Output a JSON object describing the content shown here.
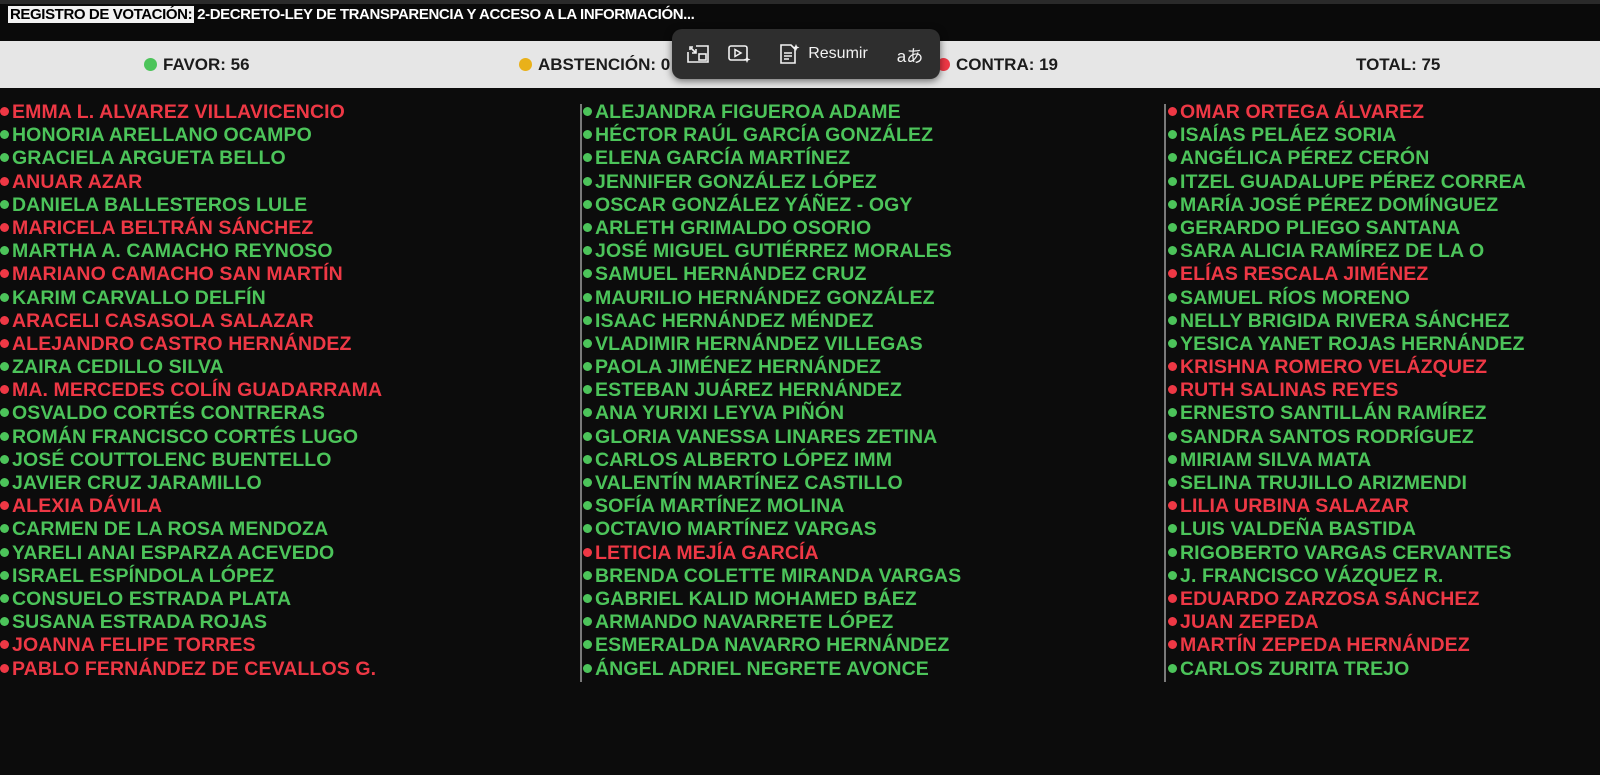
{
  "title": {
    "label": "REGISTRO DE VOTACIÓN:",
    "value": "2-DECRETO-LEY DE TRANSPARENCIA Y ACCESO A LA INFORMACIÓN..."
  },
  "summary": {
    "favor": "FAVOR: 56",
    "abstencion": "ABSTENCIÓN: 0",
    "contra": "CONTRA: 19",
    "total": "TOTAL: 75"
  },
  "colors": {
    "favor": "#4cc45a",
    "abstencion": "#e9b11a",
    "contra": "#ee3845"
  },
  "toolbar": {
    "buttons": [
      {
        "icon": "picture-in-picture-icon"
      },
      {
        "icon": "video-sparkle-icon"
      },
      {
        "icon": "summarize-icon",
        "label": "Resumir"
      },
      {
        "icon": "translate-icon",
        "glyph": "aあ"
      }
    ]
  },
  "columns": [
    [
      {
        "name": "EMMA L. ALVAREZ VILLAVICENCIO",
        "vote": "contra"
      },
      {
        "name": "HONORIA ARELLANO OCAMPO",
        "vote": "favor"
      },
      {
        "name": "GRACIELA ARGUETA BELLO",
        "vote": "favor"
      },
      {
        "name": "ANUAR AZAR",
        "vote": "contra"
      },
      {
        "name": "DANIELA BALLESTEROS LULE",
        "vote": "favor"
      },
      {
        "name": "MARICELA BELTRÁN SÁNCHEZ",
        "vote": "contra"
      },
      {
        "name": "MARTHA A. CAMACHO REYNOSO",
        "vote": "favor"
      },
      {
        "name": "MARIANO CAMACHO SAN MARTÍN",
        "vote": "contra"
      },
      {
        "name": "KARIM CARVALLO DELFÍN",
        "vote": "favor"
      },
      {
        "name": "ARACELI CASASOLA SALAZAR",
        "vote": "contra"
      },
      {
        "name": "ALEJANDRO CASTRO HERNÁNDEZ",
        "vote": "contra"
      },
      {
        "name": "ZAIRA CEDILLO SILVA",
        "vote": "favor"
      },
      {
        "name": "MA. MERCEDES COLÍN GUADARRAMA",
        "vote": "contra"
      },
      {
        "name": "OSVALDO CORTÉS CONTRERAS",
        "vote": "favor"
      },
      {
        "name": "ROMÁN FRANCISCO CORTÉS LUGO",
        "vote": "favor"
      },
      {
        "name": "JOSÉ COUTTOLENC BUENTELLO",
        "vote": "favor"
      },
      {
        "name": "JAVIER CRUZ JARAMILLO",
        "vote": "favor"
      },
      {
        "name": "ALEXIA DÁVILA",
        "vote": "contra"
      },
      {
        "name": "CARMEN DE LA ROSA MENDOZA",
        "vote": "favor"
      },
      {
        "name": "YARELI ANAI ESPARZA ACEVEDO",
        "vote": "favor"
      },
      {
        "name": "ISRAEL ESPÍNDOLA LÓPEZ",
        "vote": "favor"
      },
      {
        "name": "CONSUELO ESTRADA PLATA",
        "vote": "favor"
      },
      {
        "name": "SUSANA ESTRADA ROJAS",
        "vote": "favor"
      },
      {
        "name": "JOANNA FELIPE TORRES",
        "vote": "contra"
      },
      {
        "name": "PABLO FERNÁNDEZ DE CEVALLOS G.",
        "vote": "contra"
      }
    ],
    [
      {
        "name": "ALEJANDRA FIGUEROA ADAME",
        "vote": "favor"
      },
      {
        "name": "HÉCTOR RAÚL GARCÍA GONZÁLEZ",
        "vote": "favor"
      },
      {
        "name": "ELENA GARCÍA MARTÍNEZ",
        "vote": "favor"
      },
      {
        "name": "JENNIFER GONZÁLEZ LÓPEZ",
        "vote": "favor"
      },
      {
        "name": "OSCAR GONZÁLEZ YÁÑEZ - OGY",
        "vote": "favor"
      },
      {
        "name": "ARLETH GRIMALDO OSORIO",
        "vote": "favor"
      },
      {
        "name": "JOSÉ MIGUEL GUTIÉRREZ MORALES",
        "vote": "favor"
      },
      {
        "name": "SAMUEL HERNÁNDEZ CRUZ",
        "vote": "favor"
      },
      {
        "name": "MAURILIO HERNÁNDEZ GONZÁLEZ",
        "vote": "favor"
      },
      {
        "name": "ISAAC HERNÁNDEZ MÉNDEZ",
        "vote": "favor"
      },
      {
        "name": "VLADIMIR HERNÁNDEZ VILLEGAS",
        "vote": "favor"
      },
      {
        "name": "PAOLA JIMÉNEZ HERNÁNDEZ",
        "vote": "favor"
      },
      {
        "name": "ESTEBAN JUÁREZ HERNÁNDEZ",
        "vote": "favor"
      },
      {
        "name": "ANA YURIXI LEYVA PIÑÓN",
        "vote": "favor"
      },
      {
        "name": "GLORIA VANESSA LINARES ZETINA",
        "vote": "favor"
      },
      {
        "name": "CARLOS ALBERTO LÓPEZ IMM",
        "vote": "favor"
      },
      {
        "name": "VALENTÍN MARTÍNEZ CASTILLO",
        "vote": "favor"
      },
      {
        "name": "SOFÍA MARTÍNEZ MOLINA",
        "vote": "favor"
      },
      {
        "name": "OCTAVIO MARTÍNEZ VARGAS",
        "vote": "favor"
      },
      {
        "name": "LETICIA MEJÍA GARCÍA",
        "vote": "contra"
      },
      {
        "name": "BRENDA COLETTE MIRANDA VARGAS",
        "vote": "favor"
      },
      {
        "name": "GABRIEL KALID MOHAMED BÁEZ",
        "vote": "favor"
      },
      {
        "name": "ARMANDO NAVARRETE LÓPEZ",
        "vote": "favor"
      },
      {
        "name": "ESMERALDA NAVARRO HERNÁNDEZ",
        "vote": "favor"
      },
      {
        "name": "ÁNGEL ADRIEL NEGRETE AVONCE",
        "vote": "favor"
      }
    ],
    [
      {
        "name": "OMAR ORTEGA ÁLVAREZ",
        "vote": "contra"
      },
      {
        "name": "ISAÍAS PELÁEZ SORIA",
        "vote": "favor"
      },
      {
        "name": "ANGÉLICA PÉREZ CERÓN",
        "vote": "favor"
      },
      {
        "name": "ITZEL GUADALUPE PÉREZ CORREA",
        "vote": "favor"
      },
      {
        "name": "MARÍA JOSÉ PÉREZ DOMÍNGUEZ",
        "vote": "favor"
      },
      {
        "name": "GERARDO PLIEGO SANTANA",
        "vote": "favor"
      },
      {
        "name": "SARA ALICIA RAMÍREZ DE LA O",
        "vote": "favor"
      },
      {
        "name": "ELÍAS RESCALA JIMÉNEZ",
        "vote": "contra"
      },
      {
        "name": "SAMUEL RÍOS MORENO",
        "vote": "favor"
      },
      {
        "name": "NELLY BRIGIDA RIVERA SÁNCHEZ",
        "vote": "favor"
      },
      {
        "name": "YESICA YANET ROJAS HERNÁNDEZ",
        "vote": "favor"
      },
      {
        "name": "KRISHNA ROMERO VELÁZQUEZ",
        "vote": "contra"
      },
      {
        "name": "RUTH SALINAS REYES",
        "vote": "contra"
      },
      {
        "name": "ERNESTO SANTILLÁN RAMÍREZ",
        "vote": "favor"
      },
      {
        "name": "SANDRA SANTOS RODRÍGUEZ",
        "vote": "favor"
      },
      {
        "name": "MIRIAM SILVA MATA",
        "vote": "favor"
      },
      {
        "name": "SELINA TRUJILLO ARIZMENDI",
        "vote": "favor"
      },
      {
        "name": "LILIA URBINA SALAZAR",
        "vote": "contra"
      },
      {
        "name": "LUIS VALDEÑA BASTIDA",
        "vote": "favor"
      },
      {
        "name": "RIGOBERTO VARGAS CERVANTES",
        "vote": "favor"
      },
      {
        "name": "J. FRANCISCO VÁZQUEZ R.",
        "vote": "favor"
      },
      {
        "name": "EDUARDO ZARZOSA SÁNCHEZ",
        "vote": "contra"
      },
      {
        "name": "JUAN ZEPEDA",
        "vote": "contra"
      },
      {
        "name": "MARTÍN ZEPEDA HERNÁNDEZ",
        "vote": "contra"
      },
      {
        "name": "CARLOS ZURITA TREJO",
        "vote": "favor"
      }
    ]
  ]
}
